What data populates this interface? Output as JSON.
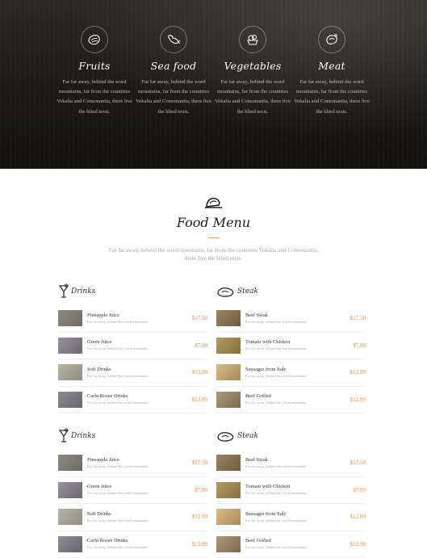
{
  "services": [
    {
      "icon": "fruit-icon",
      "title": "Fruits",
      "text": "Far far away, behind the word mountains, far from the countries Vokalia and Consonantia, there live the blind texts."
    },
    {
      "icon": "seafood-icon",
      "title": "Sea food",
      "text": "Far far away, behind the word mountains, far from the countries Vokalia and Consonantia, there live the blind texts."
    },
    {
      "icon": "vegetables-icon",
      "title": "Vegetables",
      "text": "Far far away, behind the word mountains, far from the countries Vokalia and Consonantia, there live the blind texts."
    },
    {
      "icon": "meat-icon",
      "title": "Meat",
      "text": "Far far away, behind the word mountains, far from the countries Vokalia and Consonantia, there live the blind texts."
    }
  ],
  "menu": {
    "icon": "dish-icon",
    "title": "Food Menu",
    "subtitle": "Far far away, behind the word mountains, far from the countries Vokalia and Consonantia, there live the blind texts."
  },
  "blocks": [
    {
      "drinks": {
        "title": "Drinks",
        "items": [
          {
            "name": "Pineapple Juice",
            "desc": "Far far away, behind the word mountains.",
            "price": "$17.50",
            "color": "#7a7770"
          },
          {
            "name": "Green Juice",
            "desc": "Far far away, behind the word mountains.",
            "price": "$7.99",
            "color": "#85808a"
          },
          {
            "name": "Soft Drinks",
            "desc": "Far far away, behind the word mountains.",
            "price": "$13.99",
            "color": "#a6a596"
          },
          {
            "name": "Carlo Rosee Drinks",
            "desc": "Far far away, behind the word mountains.",
            "price": "$13.99",
            "color": "#7d7b84"
          }
        ]
      },
      "steak": {
        "title": "Steak",
        "items": [
          {
            "name": "Beef Steak",
            "desc": "Far far away, behind the word mountains.",
            "price": "$17.50",
            "color": "#8a7654"
          },
          {
            "name": "Tomato with Chicken",
            "desc": "Far far away, behind the word mountains.",
            "price": "$7.99",
            "color": "#a48a5a"
          },
          {
            "name": "Sausages from Italy",
            "desc": "Far far away, behind the word mountains.",
            "price": "$12.99",
            "color": "#c7a878"
          },
          {
            "name": "Beef Grilled",
            "desc": "Far far away, behind the word mountains.",
            "price": "$12.99",
            "color": "#9c8a6c"
          }
        ]
      }
    },
    {
      "drinks": {
        "title": "Drinks",
        "items": [
          {
            "name": "Pineapple Juice",
            "desc": "Far far away, behind the word mountains.",
            "price": "$17.50",
            "color": "#7a7770"
          },
          {
            "name": "Green Juice",
            "desc": "Far far away, behind the word mountains.",
            "price": "$7.99",
            "color": "#85808a"
          },
          {
            "name": "Soft Drinks",
            "desc": "Far far away, behind the word mountains.",
            "price": "$12.99",
            "color": "#a6a596"
          },
          {
            "name": "Carlo Rosee Drinks",
            "desc": "Far far away, behind the word mountains.",
            "price": "$13.99",
            "color": "#7d7b84"
          }
        ]
      },
      "steak": {
        "title": "Steak",
        "items": [
          {
            "name": "Beef Steak",
            "desc": "Far far away, behind the word mountains.",
            "price": "$17.50",
            "color": "#8a7654"
          },
          {
            "name": "Tomato with Chicken",
            "desc": "Far far away, behind the word mountains.",
            "price": "$7.99",
            "color": "#a48a5a"
          },
          {
            "name": "Sausages from Italy",
            "desc": "Far far away, behind the word mountains.",
            "price": "$12.99",
            "color": "#c7a878"
          },
          {
            "name": "Beef Grilled",
            "desc": "Far far away, behind the word mountains.",
            "price": "$12.99",
            "color": "#9c8a6c"
          }
        ]
      }
    }
  ],
  "colors": {
    "accent": "#f08a3c",
    "hero_bg": "#1a1917"
  }
}
